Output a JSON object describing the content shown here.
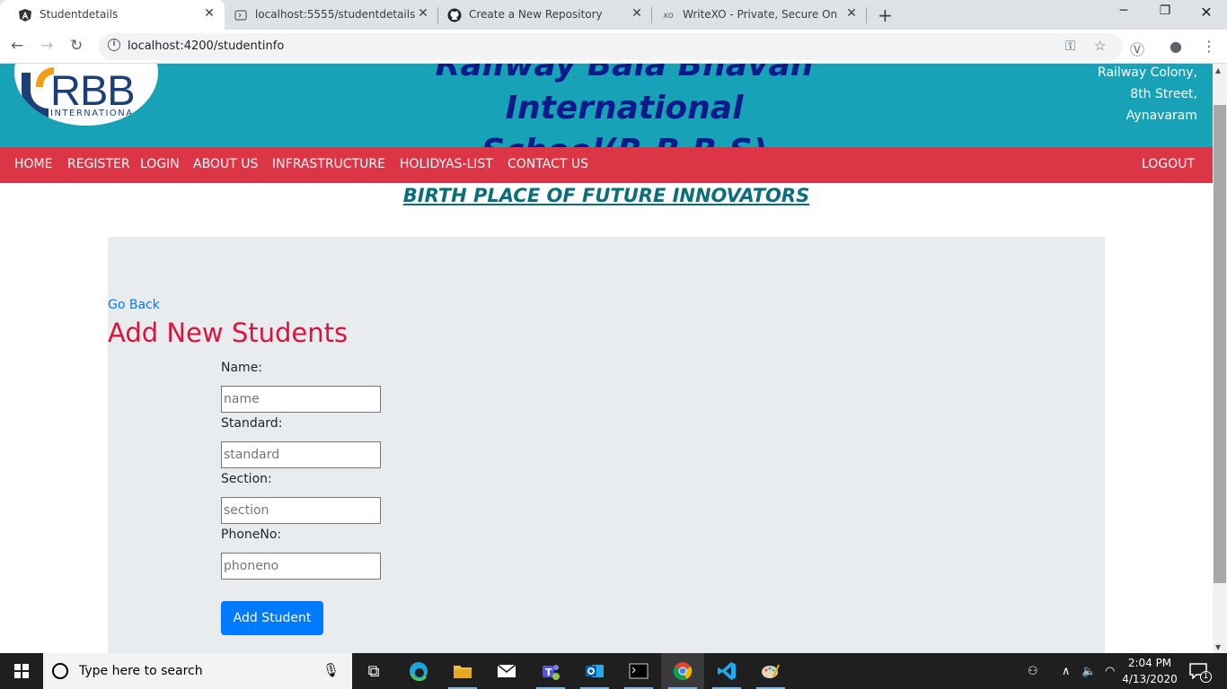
{
  "browser": {
    "tabs": [
      {
        "title": "Studentdetails",
        "icon": "angular-icon"
      },
      {
        "title": "localhost:5555/studentdetails",
        "icon": "page-icon"
      },
      {
        "title": "Create a New Repository",
        "icon": "github-icon"
      },
      {
        "title": "WriteXO - Private, Secure Online",
        "icon": "writexo-icon",
        "favicon_text": "xo"
      }
    ],
    "url": "localhost:4200/studentinfo"
  },
  "header": {
    "logo_text": "RBB",
    "logo_sub": "INTERNATIONA",
    "school_line1": "Railway Bala Bhavan International",
    "school_line2": "School(R.B.B.S)",
    "address": [
      "Railway Colony,",
      "8th Street,",
      "Aynavaram"
    ]
  },
  "nav": {
    "items": [
      "HOME",
      "REGISTER",
      "LOGIN",
      "ABOUT US",
      "INFRASTRUCTURE",
      "HOLIDYAS-LIST",
      "CONTACT US"
    ],
    "logout": "LOGOUT"
  },
  "tagline": "BIRTH PLACE OF FUTURE INNOVATORS",
  "form": {
    "go_back": "Go Back",
    "heading": "Add New Students",
    "fields": [
      {
        "label": "Name:",
        "placeholder": "name",
        "value": ""
      },
      {
        "label": "Standard:",
        "placeholder": "standard",
        "value": ""
      },
      {
        "label": "Section:",
        "placeholder": "section",
        "value": ""
      },
      {
        "label": "PhoneNo:",
        "placeholder": "phoneno",
        "value": ""
      }
    ],
    "submit": "Add Student"
  },
  "taskbar": {
    "search_placeholder": "Type here to search",
    "time": "2:04 PM",
    "date": "4/13/2020",
    "notification_count": "1"
  },
  "colors": {
    "header_bg": "#17a2b8",
    "nav_bg": "#dc3545",
    "heading": "#dc143c",
    "link": "#007bff",
    "panel_bg": "#e9ecef"
  }
}
